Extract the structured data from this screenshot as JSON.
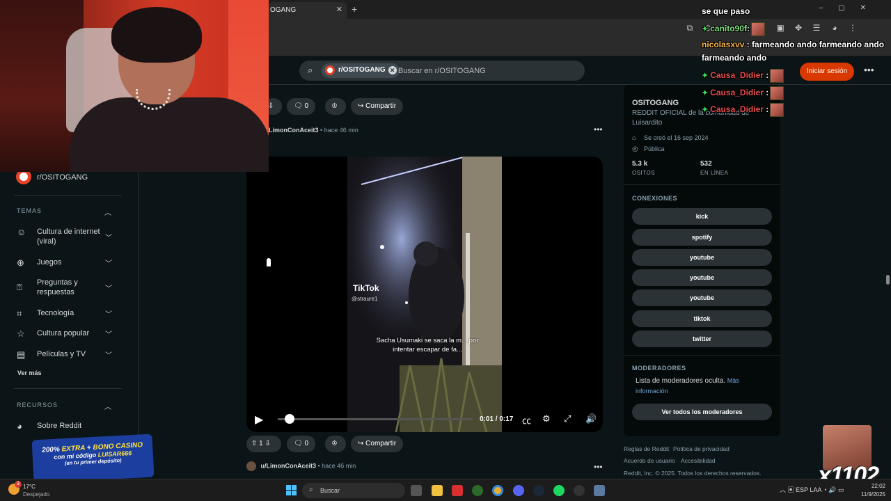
{
  "browser": {
    "tab_title": "OGANG",
    "new_tab": "+",
    "close": "✕"
  },
  "search": {
    "chip_label": "r/OSITOGANG",
    "placeholder": "Buscar en r/OSITOGANG"
  },
  "header": {
    "login_label": "Iniciar sesión",
    "more": "•••"
  },
  "sidebar": {
    "subreddit": "r/OSITOGANG",
    "temas_title": "TEMAS",
    "temas": [
      {
        "label": "Cultura de internet (viral)",
        "icon": "smile-icon"
      },
      {
        "label": "Juegos",
        "icon": "gamepad-icon"
      },
      {
        "label": "Preguntas y respuestas",
        "icon": "question-icon"
      },
      {
        "label": "Tecnología",
        "icon": "chip-icon"
      },
      {
        "label": "Cultura popular",
        "icon": "star-icon"
      },
      {
        "label": "Películas y TV",
        "icon": "clapper-icon"
      }
    ],
    "ver_mas": "Ver más",
    "recursos_title": "RECURSOS",
    "recursos": [
      {
        "label": "Sobre Reddit",
        "icon": "reddit-icon"
      }
    ]
  },
  "feed": {
    "top_actions": {
      "comments": "0",
      "share": "Compartir"
    },
    "post": {
      "author": "LimonConAceit3",
      "time": "hace 46 min",
      "tiktok_brand": "TikTok",
      "tiktok_user": "@straure1",
      "caption": "Sacha Usumaki se saca la m... por intentar escapar de fa...",
      "video_time": "0:01 / 0:17",
      "progress": 0.06,
      "votes": "1",
      "comments": "0",
      "share": "Compartir"
    },
    "next_post": {
      "author": "u/LimonConAceit3",
      "time": "hace 46 min"
    }
  },
  "community": {
    "name": "OSITOGANG",
    "description": "REDDIT OFICIAL de la comunidad de Luisardito",
    "created": "Se creó el 16 sep 2024",
    "visibility": "Pública",
    "members": "5.3 k",
    "members_label": "OSITOS",
    "online": "532",
    "online_label": "EN LÍNEA",
    "connections_title": "CONEXIONES",
    "connections": [
      "kick",
      "spotify",
      "youtube",
      "youtube",
      "youtube",
      "tiktok",
      "twitter"
    ],
    "mods_title": "MODERADORES",
    "mods_text": "Lista de moderadores oculta.",
    "mods_link": "Más información",
    "mods_button": "Ver todos los moderadores"
  },
  "footer": {
    "links": [
      "Reglas de Reddit",
      "Política de privacidad",
      "Acuerdo de usuario",
      "Accesibilidad"
    ],
    "copyright": "Reddit, Inc. © 2025. Todos los derechos reservados."
  },
  "chat": {
    "lines": [
      {
        "user": "",
        "text": "se que paso"
      },
      {
        "user": "canito90f",
        "text": ":",
        "color": "g"
      },
      {
        "user": "nicolasxvv",
        "text": ": farmeando ando farmeando ando",
        "color": "o"
      },
      {
        "user": "",
        "text": "farmeando ando"
      },
      {
        "user": "Causa_Didier",
        "text": ":"
      },
      {
        "user": "Causa_Didier",
        "text": ":"
      },
      {
        "user": "Causa_Didier",
        "text": ":"
      }
    ]
  },
  "promo": {
    "line1_a": "200% ",
    "line1_b": "EXTRA",
    "line1_c": " + ",
    "line1_d": "BONO CASINO",
    "line2_a": "con mi código ",
    "line2_b": "LUISAR666",
    "line3": "(en tu primer depósito)"
  },
  "overlay": {
    "count": "x1102"
  },
  "taskbar": {
    "weather_temp": "17°C",
    "weather_desc": "Despejado",
    "weather_badge": "3",
    "search": "Buscar",
    "lang": "ESP LAA",
    "time": "22:02",
    "date": "11/9/2025"
  },
  "colors": {
    "accent": "#d93900",
    "bg": "#0b1416",
    "pill": "#2a3236"
  }
}
